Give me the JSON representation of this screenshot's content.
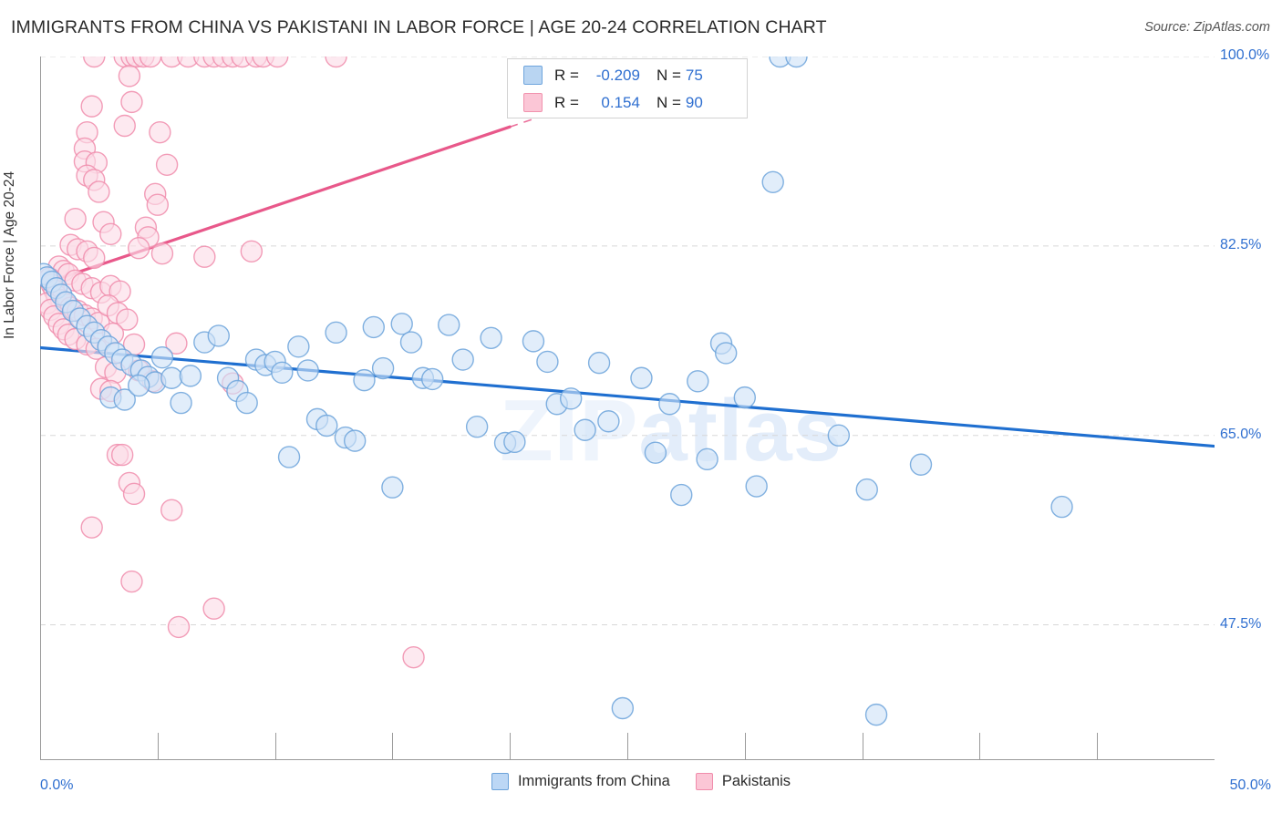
{
  "header": {
    "title": "IMMIGRANTS FROM CHINA VS PAKISTANI IN LABOR FORCE | AGE 20-24 CORRELATION CHART",
    "source": "Source: ZipAtlas.com"
  },
  "watermark": {
    "part1": "ZIP",
    "part2": "atlas"
  },
  "stats": {
    "blue": {
      "r_label": "R =",
      "r_value": "-0.209",
      "n_label": "N =",
      "n_value": "75"
    },
    "pink": {
      "r_label": "R =",
      "r_value": "0.154",
      "n_label": "N =",
      "n_value": "90"
    }
  },
  "axes": {
    "y_title": "In Labor Force | Age 20-24",
    "y_ticks": [
      "100.0%",
      "82.5%",
      "65.0%",
      "47.5%"
    ],
    "x_ticks": [
      "0.0%",
      "50.0%"
    ]
  },
  "legend": {
    "items": [
      {
        "label": "Immigrants from China",
        "color": "#bcd7f5"
      },
      {
        "label": "Pakistanis",
        "color": "#fbc6d6"
      }
    ]
  },
  "colors": {
    "blue_fill": "#cfe2f7",
    "blue_stroke": "#6ca3da",
    "pink_fill": "#fbdce7",
    "pink_stroke": "#f08cab",
    "blue_line": "#1f6fd0",
    "pink_line": "#e8588a",
    "grid": "#d8d8d8",
    "axis": "#9a9a9a",
    "tick_text": "#2f6fd0"
  },
  "chart_data": {
    "type": "scatter",
    "title": "IMMIGRANTS FROM CHINA VS PAKISTANI IN LABOR FORCE | AGE 20-24 CORRELATION CHART",
    "xlabel": "",
    "ylabel": "In Labor Force | Age 20-24",
    "xlim": [
      0.0,
      50.0
    ],
    "ylim": [
      35.0,
      100.0
    ],
    "x_tick_values": [
      0.0,
      50.0
    ],
    "y_tick_values": [
      100.0,
      82.5,
      65.0,
      47.5
    ],
    "grid": true,
    "legend_position": "bottom",
    "series": [
      {
        "name": "Immigrants from China",
        "color": "#cfe2f7",
        "stroke": "#6ca3da",
        "r": -0.209,
        "n": 75,
        "trendline": {
          "x0": 0.0,
          "y0": 73.1,
          "x1": 50.0,
          "y1": 64.0,
          "style": "solid",
          "color": "#1f6fd0"
        },
        "points": [
          [
            0.15,
            79.9
          ],
          [
            0.3,
            79.6
          ],
          [
            0.5,
            79.2
          ],
          [
            0.7,
            78.6
          ],
          [
            0.9,
            78.0
          ],
          [
            1.1,
            77.3
          ],
          [
            1.4,
            76.5
          ],
          [
            1.7,
            75.8
          ],
          [
            2.0,
            75.1
          ],
          [
            2.3,
            74.5
          ],
          [
            2.6,
            73.8
          ],
          [
            2.9,
            73.2
          ],
          [
            3.2,
            72.6
          ],
          [
            3.5,
            72.0
          ],
          [
            3.9,
            71.5
          ],
          [
            4.3,
            71.0
          ],
          [
            4.6,
            70.4
          ],
          [
            4.9,
            69.9
          ],
          [
            3.0,
            68.5
          ],
          [
            3.6,
            68.3
          ],
          [
            4.2,
            69.6
          ],
          [
            5.2,
            72.2
          ],
          [
            5.6,
            70.3
          ],
          [
            6.0,
            68.0
          ],
          [
            6.4,
            70.5
          ],
          [
            7.0,
            73.6
          ],
          [
            7.6,
            74.2
          ],
          [
            8.0,
            70.3
          ],
          [
            8.4,
            69.1
          ],
          [
            8.8,
            68.0
          ],
          [
            9.2,
            72.0
          ],
          [
            9.6,
            71.5
          ],
          [
            10.0,
            71.8
          ],
          [
            10.3,
            70.8
          ],
          [
            10.6,
            63.0
          ],
          [
            11.0,
            73.2
          ],
          [
            11.4,
            71.0
          ],
          [
            11.8,
            66.5
          ],
          [
            12.2,
            65.9
          ],
          [
            12.6,
            74.5
          ],
          [
            13.0,
            64.8
          ],
          [
            13.4,
            64.5
          ],
          [
            13.8,
            70.1
          ],
          [
            14.2,
            75.0
          ],
          [
            14.6,
            71.2
          ],
          [
            15.0,
            60.2
          ],
          [
            15.4,
            75.3
          ],
          [
            15.8,
            73.6
          ],
          [
            16.3,
            70.3
          ],
          [
            16.7,
            70.2
          ],
          [
            17.4,
            75.2
          ],
          [
            18.0,
            72.0
          ],
          [
            18.6,
            65.8
          ],
          [
            19.2,
            74.0
          ],
          [
            19.8,
            64.3
          ],
          [
            20.2,
            64.4
          ],
          [
            21.0,
            73.7
          ],
          [
            21.6,
            71.8
          ],
          [
            22.0,
            67.9
          ],
          [
            22.6,
            68.4
          ],
          [
            23.2,
            65.5
          ],
          [
            23.8,
            71.7
          ],
          [
            24.2,
            66.3
          ],
          [
            24.8,
            39.8
          ],
          [
            25.6,
            70.3
          ],
          [
            26.2,
            63.4
          ],
          [
            26.8,
            67.9
          ],
          [
            27.3,
            59.5
          ],
          [
            28.0,
            70.0
          ],
          [
            28.4,
            62.8
          ],
          [
            29.0,
            73.5
          ],
          [
            29.2,
            72.6
          ],
          [
            30.0,
            68.5
          ],
          [
            30.5,
            60.3
          ],
          [
            31.2,
            88.4
          ],
          [
            31.5,
            100.0
          ],
          [
            32.2,
            100.0
          ],
          [
            34.0,
            65.0
          ],
          [
            35.2,
            60.0
          ],
          [
            35.6,
            39.2
          ],
          [
            37.5,
            62.3
          ],
          [
            43.5,
            58.4
          ]
        ]
      },
      {
        "name": "Pakistanis",
        "color": "#fbdce7",
        "stroke": "#f08cab",
        "r": 0.154,
        "n": 90,
        "trendline": {
          "x0": 0.0,
          "y0": 78.9,
          "x1": 20.0,
          "y1": 93.5,
          "style": "solid-then-dashed",
          "dash_start_x": 20.0,
          "dash_end_x": 24.5,
          "color": "#e8588a"
        },
        "points": [
          [
            2.3,
            100.0
          ],
          [
            3.6,
            100.0
          ],
          [
            3.9,
            100.0
          ],
          [
            4.1,
            100.0
          ],
          [
            4.4,
            100.0
          ],
          [
            4.7,
            100.0
          ],
          [
            5.6,
            100.0
          ],
          [
            6.3,
            100.0
          ],
          [
            7.0,
            100.0
          ],
          [
            7.4,
            100.0
          ],
          [
            7.8,
            100.0
          ],
          [
            8.2,
            100.0
          ],
          [
            8.6,
            100.0
          ],
          [
            9.2,
            100.0
          ],
          [
            9.5,
            100.0
          ],
          [
            10.1,
            100.0
          ],
          [
            12.6,
            100.0
          ],
          [
            3.8,
            98.2
          ],
          [
            3.9,
            95.8
          ],
          [
            2.2,
            95.4
          ],
          [
            2.0,
            93.0
          ],
          [
            3.6,
            93.6
          ],
          [
            5.1,
            93.0
          ],
          [
            1.9,
            91.5
          ],
          [
            1.9,
            90.3
          ],
          [
            2.4,
            90.2
          ],
          [
            5.4,
            90.0
          ],
          [
            2.0,
            89.0
          ],
          [
            2.3,
            88.6
          ],
          [
            2.5,
            87.5
          ],
          [
            4.9,
            87.3
          ],
          [
            5.0,
            86.3
          ],
          [
            1.5,
            85.0
          ],
          [
            2.7,
            84.7
          ],
          [
            3.0,
            83.6
          ],
          [
            4.5,
            84.2
          ],
          [
            4.6,
            83.3
          ],
          [
            1.3,
            82.6
          ],
          [
            1.6,
            82.2
          ],
          [
            2.0,
            82.0
          ],
          [
            2.3,
            81.4
          ],
          [
            4.2,
            82.3
          ],
          [
            5.2,
            81.8
          ],
          [
            7.0,
            81.5
          ],
          [
            9.0,
            82.0
          ],
          [
            0.8,
            80.6
          ],
          [
            1.0,
            80.2
          ],
          [
            1.2,
            79.9
          ],
          [
            1.5,
            79.3
          ],
          [
            1.8,
            79.0
          ],
          [
            2.2,
            78.6
          ],
          [
            2.6,
            78.2
          ],
          [
            3.0,
            78.8
          ],
          [
            3.4,
            78.3
          ],
          [
            0.4,
            79.5
          ],
          [
            0.5,
            78.9
          ],
          [
            0.6,
            78.4
          ],
          [
            0.7,
            77.9
          ],
          [
            0.9,
            77.5
          ],
          [
            1.1,
            77.1
          ],
          [
            1.3,
            76.8
          ],
          [
            1.6,
            76.5
          ],
          [
            1.9,
            76.1
          ],
          [
            2.2,
            75.8
          ],
          [
            2.5,
            75.4
          ],
          [
            2.9,
            77.0
          ],
          [
            3.3,
            76.3
          ],
          [
            3.7,
            75.7
          ],
          [
            0.3,
            77.2
          ],
          [
            0.45,
            76.6
          ],
          [
            0.6,
            76.0
          ],
          [
            0.8,
            75.3
          ],
          [
            1.0,
            74.8
          ],
          [
            1.2,
            74.3
          ],
          [
            1.5,
            73.9
          ],
          [
            2.0,
            73.4
          ],
          [
            2.4,
            73.0
          ],
          [
            3.1,
            74.4
          ],
          [
            4.0,
            73.4
          ],
          [
            5.8,
            73.5
          ],
          [
            2.8,
            71.3
          ],
          [
            3.2,
            70.8
          ],
          [
            4.2,
            71.0
          ],
          [
            4.8,
            70.0
          ],
          [
            2.6,
            69.3
          ],
          [
            3.0,
            69.1
          ],
          [
            8.2,
            69.8
          ],
          [
            3.3,
            63.2
          ],
          [
            3.5,
            63.2
          ],
          [
            3.8,
            60.6
          ],
          [
            4.0,
            59.6
          ],
          [
            5.6,
            58.1
          ],
          [
            2.2,
            56.5
          ],
          [
            3.9,
            51.5
          ],
          [
            7.4,
            49.0
          ],
          [
            5.9,
            47.3
          ],
          [
            15.9,
            44.5
          ]
        ]
      }
    ]
  }
}
